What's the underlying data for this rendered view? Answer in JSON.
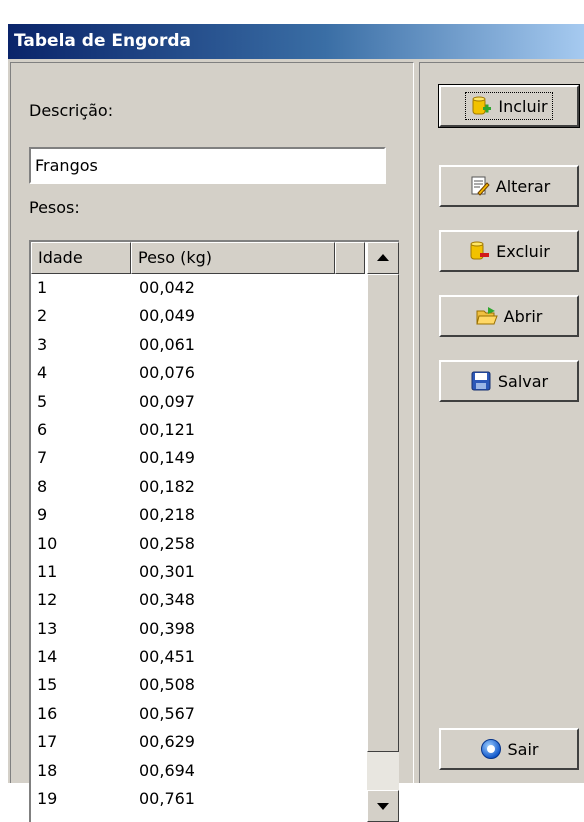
{
  "window": {
    "title": "Tabela de Engorda"
  },
  "form": {
    "descricao_label": "Descrição:",
    "descricao_value": "Frangos",
    "pesos_label": "Pesos:"
  },
  "grid": {
    "columns": [
      "Idade",
      "Peso (kg)"
    ],
    "rows": [
      {
        "idade": "1",
        "peso": "00,042"
      },
      {
        "idade": "2",
        "peso": "00,049"
      },
      {
        "idade": "3",
        "peso": "00,061"
      },
      {
        "idade": "4",
        "peso": "00,076"
      },
      {
        "idade": "5",
        "peso": "00,097"
      },
      {
        "idade": "6",
        "peso": "00,121"
      },
      {
        "idade": "7",
        "peso": "00,149"
      },
      {
        "idade": "8",
        "peso": "00,182"
      },
      {
        "idade": "9",
        "peso": "00,218"
      },
      {
        "idade": "10",
        "peso": "00,258"
      },
      {
        "idade": "11",
        "peso": "00,301"
      },
      {
        "idade": "12",
        "peso": "00,348"
      },
      {
        "idade": "13",
        "peso": "00,398"
      },
      {
        "idade": "14",
        "peso": "00,451"
      },
      {
        "idade": "15",
        "peso": "00,508"
      },
      {
        "idade": "16",
        "peso": "00,567"
      },
      {
        "idade": "17",
        "peso": "00,629"
      },
      {
        "idade": "18",
        "peso": "00,694"
      },
      {
        "idade": "19",
        "peso": "00,761"
      }
    ]
  },
  "buttons": {
    "incluir": "Incluir",
    "alterar": "Alterar",
    "excluir": "Excluir",
    "abrir": "Abrir",
    "salvar": "Salvar",
    "sair": "Sair"
  },
  "icons": {
    "incluir": "database-add-icon",
    "alterar": "edit-document-icon",
    "excluir": "database-remove-icon",
    "abrir": "open-folder-icon",
    "salvar": "save-disk-icon",
    "sair": "exit-circle-icon"
  },
  "colors": {
    "titlebar_start": "#0a246a",
    "titlebar_end": "#a6caf0",
    "face": "#d4d0c8"
  }
}
